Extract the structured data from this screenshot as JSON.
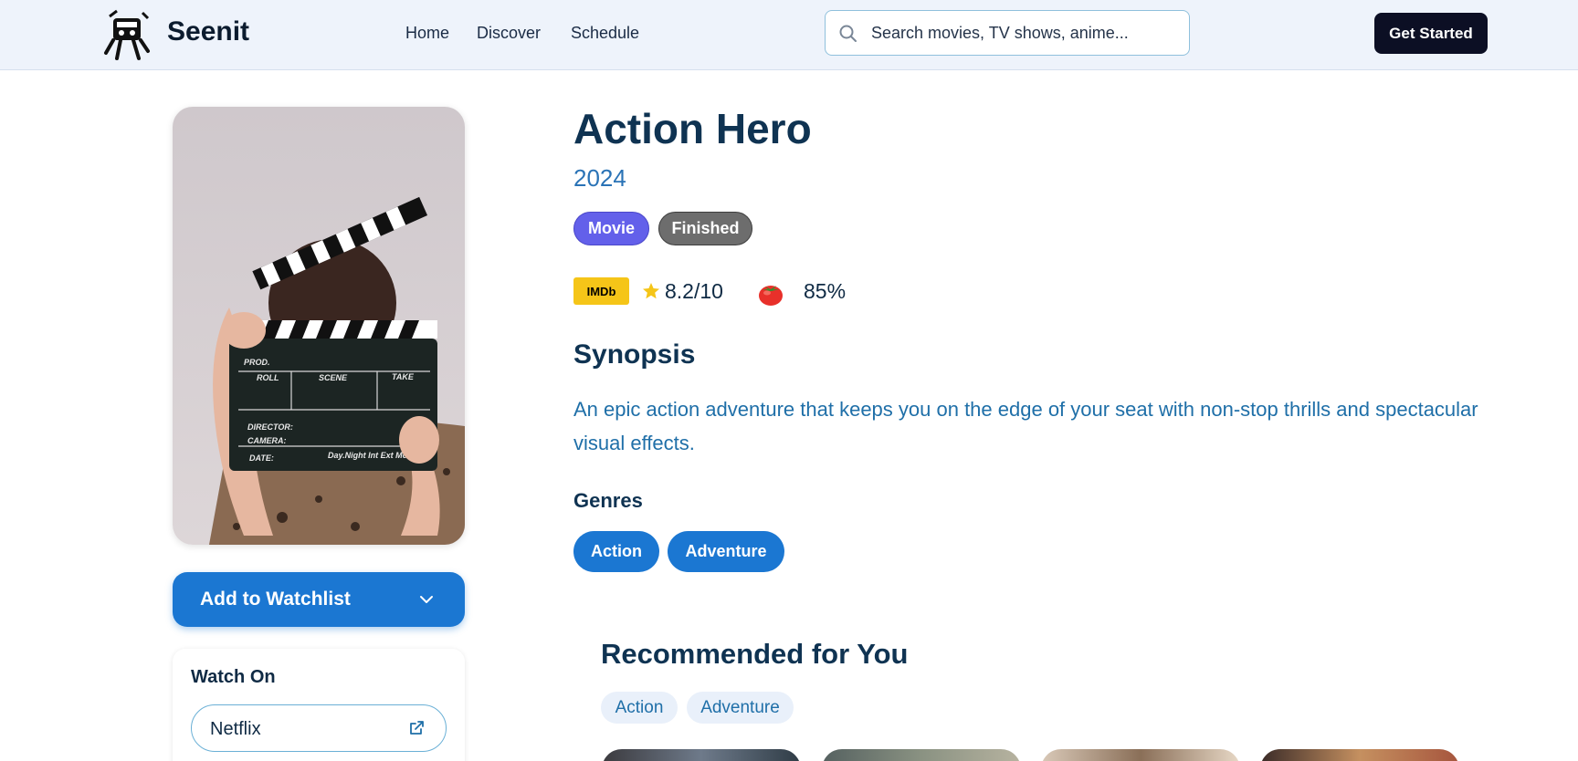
{
  "header": {
    "brand": "Seenit",
    "logo_icon": "running-mascot-logo",
    "nav": [
      "Home",
      "Discover",
      "Schedule"
    ],
    "search_placeholder": "Search movies, TV shows, anime...",
    "cta_label": "Get Started"
  },
  "sidebar": {
    "watchlist_label": "Add to Watchlist",
    "watch_on_title": "Watch On",
    "providers": [
      {
        "name": "Netflix",
        "icon": "external-link-icon"
      }
    ]
  },
  "media": {
    "title": "Action Hero",
    "year": "2024",
    "type_badge": "Movie",
    "status_badge": "Finished",
    "imdb_label": "IMDb",
    "imdb_score": "8.2/10",
    "rt_score": "85%",
    "synopsis_heading": "Synopsis",
    "synopsis": "An epic action adventure that keeps you on the edge of your seat with non-stop thrills and spectacular visual effects.",
    "genres_heading": "Genres",
    "genres": [
      "Action",
      "Adventure"
    ]
  },
  "recommended": {
    "heading": "Recommended for You",
    "filters": [
      "Action",
      "Adventure"
    ]
  },
  "colors": {
    "primary": "#1b77d2",
    "badge_movie": "#6360ea",
    "badge_status": "#6d6d6d",
    "imdb": "#f5c518",
    "dark_button": "#0c0f24",
    "heading": "#0f3352"
  }
}
